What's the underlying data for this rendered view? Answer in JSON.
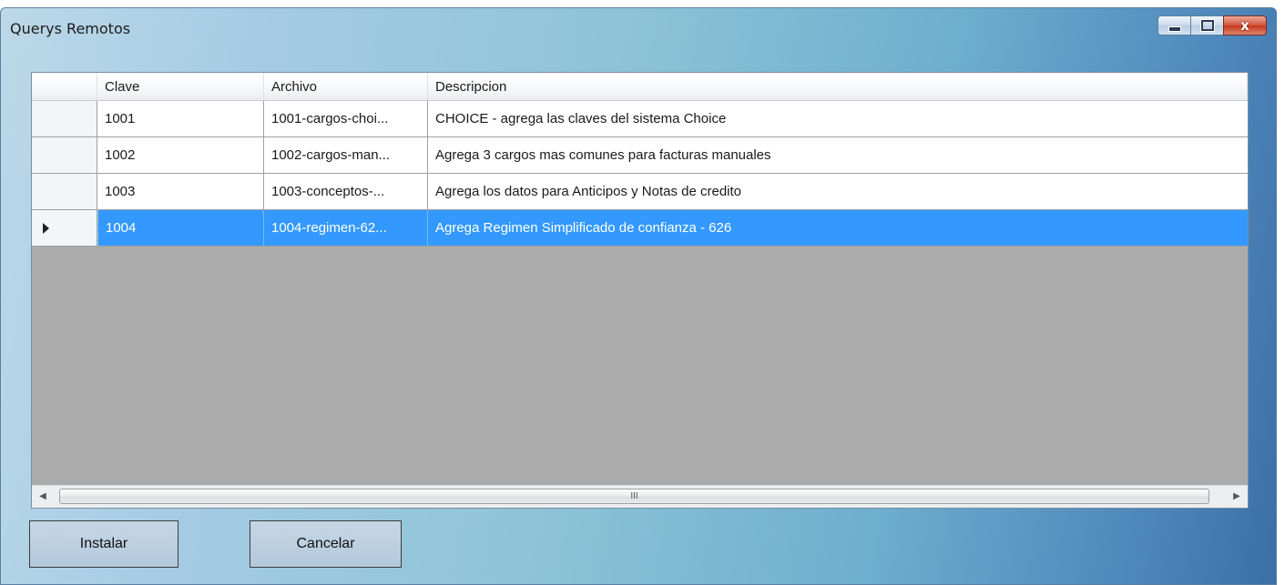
{
  "window": {
    "title": "Querys Remotos",
    "close_glyph": "x",
    "min_icon": "minimize-icon",
    "max_icon": "maximize-icon",
    "close_icon": "close-icon"
  },
  "grid": {
    "columns": [
      "Clave",
      "Archivo",
      "Descripcion"
    ],
    "rows": [
      {
        "clave": "1001",
        "archivo": "1001-cargos-choi...",
        "descripcion": "CHOICE - agrega las claves del sistema Choice"
      },
      {
        "clave": "1002",
        "archivo": "1002-cargos-man...",
        "descripcion": "Agrega 3 cargos mas comunes para facturas manuales"
      },
      {
        "clave": "1003",
        "archivo": "1003-conceptos-...",
        "descripcion": "Agrega los datos para Anticipos y Notas de credito"
      },
      {
        "clave": "1004",
        "archivo": "1004-regimen-62...",
        "descripcion": "Agrega Regimen Simplificado de confianza - 626"
      }
    ],
    "selected_row": 3,
    "scroll_left": "◀",
    "scroll_right": "▶",
    "scroll_grip": "III",
    "colors": {
      "selection": "#3399ff",
      "empty_area": "#ababab"
    }
  },
  "buttons": {
    "install": "Instalar",
    "cancel": "Cancelar"
  }
}
